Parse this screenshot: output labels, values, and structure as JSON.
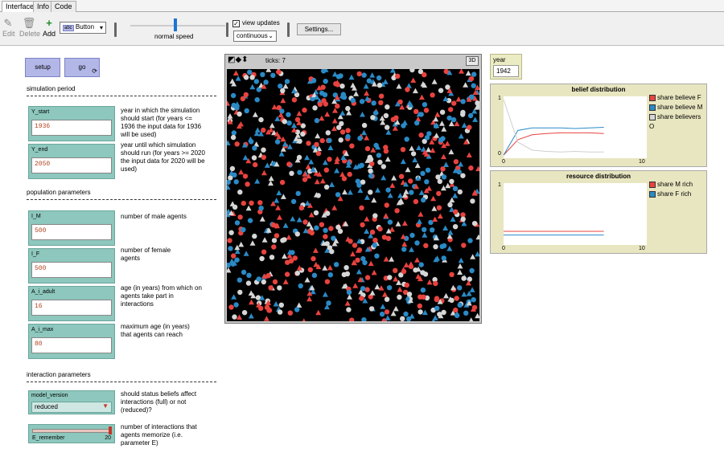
{
  "tabs": [
    "Interface",
    "Info",
    "Code"
  ],
  "toolbar": {
    "edit": "Edit",
    "delete": "Delete",
    "add": "Add",
    "widget_type": "Button",
    "speed_label": "normal speed",
    "speed_level": 0.5,
    "view_updates": "view updates",
    "view_updates_checked": true,
    "update_mode": "continuous",
    "settings": "Settings..."
  },
  "buttons": {
    "setup": "setup",
    "go": "go"
  },
  "sections": {
    "simulation": "simulation period",
    "population": "population parameters",
    "interaction": "interaction parameters"
  },
  "inputs": [
    {
      "label": "Y_start",
      "value": "1936",
      "desc": [
        "year in which the simulation",
        "should start (for years <=",
        "1936 the input data for 1936",
        "will be used)"
      ]
    },
    {
      "label": "Y_end",
      "value": "2050",
      "desc": [
        "year until which simulation",
        "should run (for years >= 2020",
        "the input data for 2020 will be",
        "used)"
      ]
    },
    {
      "label": "I_M",
      "value": "500",
      "desc": [
        "number of male agents"
      ]
    },
    {
      "label": "I_F",
      "value": "500",
      "desc": [
        "number of female",
        "agents"
      ]
    },
    {
      "label": "A_i_adult",
      "value": "16",
      "desc": [
        "age (in years) from which on",
        "agents take part in",
        "interactions"
      ]
    },
    {
      "label": "A_i_max",
      "value": "80",
      "desc": [
        "maximum age (in years)",
        "that agents can reach"
      ]
    }
  ],
  "chooser": {
    "label": "model_version",
    "value": "reduced",
    "desc": [
      "should status beliefs affect",
      "interactions (full) or not",
      "(reduced)?"
    ]
  },
  "slider": {
    "label": "E_remember",
    "value": "20",
    "fraction": 1.0,
    "desc": [
      "number of interactions that",
      "agents memorize (i.e.",
      "parameter E)"
    ]
  },
  "world": {
    "ticks": "ticks: 7",
    "btn3d": "3D"
  },
  "monitor": {
    "label": "year",
    "value": "1942"
  },
  "colors": {
    "red": "#e8433f",
    "blue": "#2a8ac6",
    "grey": "#d6d6d6"
  },
  "chart_data": [
    {
      "type": "line",
      "title": "belief distribution",
      "xlim": [
        0,
        10
      ],
      "ylim": [
        0,
        1
      ],
      "x_ticks": [
        "0",
        "10"
      ],
      "y_ticks": [
        "0",
        "1"
      ],
      "series": [
        {
          "name": "share believe F",
          "color": "#e8433f",
          "x": [
            0,
            1,
            2,
            3,
            4,
            5,
            6,
            7
          ],
          "y": [
            0.05,
            0.3,
            0.38,
            0.4,
            0.41,
            0.41,
            0.41,
            0.4
          ]
        },
        {
          "name": "share believe M",
          "color": "#2a8ac6",
          "x": [
            0,
            1,
            2,
            3,
            4,
            5,
            6,
            7
          ],
          "y": [
            0.05,
            0.45,
            0.49,
            0.49,
            0.49,
            0.48,
            0.49,
            0.5
          ]
        },
        {
          "name": "share believers O",
          "color": "#cfcfcf",
          "x": [
            0,
            1,
            2,
            3,
            4,
            5,
            6,
            7
          ],
          "y": [
            0.95,
            0.26,
            0.13,
            0.11,
            0.1,
            0.11,
            0.1,
            0.1
          ]
        }
      ]
    },
    {
      "type": "line",
      "title": "resource distribution",
      "xlim": [
        0,
        10
      ],
      "ylim": [
        0,
        1
      ],
      "x_ticks": [
        "0",
        "10"
      ],
      "y_ticks": [
        "0",
        "1"
      ],
      "series": [
        {
          "name": "share M rich",
          "color": "#e8433f",
          "x": [
            0,
            7
          ],
          "y": [
            0.22,
            0.22
          ]
        },
        {
          "name": "share F rich",
          "color": "#2a8ac6",
          "x": [
            0,
            7
          ],
          "y": [
            0.16,
            0.16
          ]
        }
      ]
    }
  ]
}
